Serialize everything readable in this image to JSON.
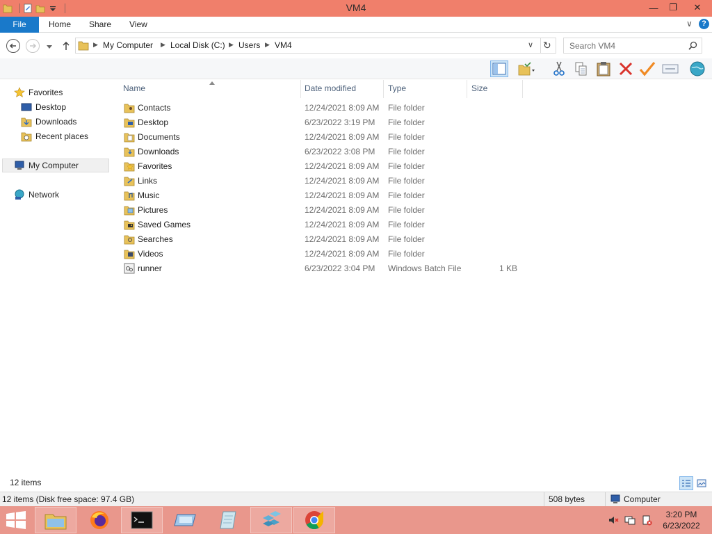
{
  "window": {
    "title": "VM4",
    "minimize_glyph": "—",
    "restore_glyph": "❐",
    "close_glyph": "✕"
  },
  "ribbon": {
    "tabs": [
      {
        "label": "File"
      },
      {
        "label": "Home"
      },
      {
        "label": "Share"
      },
      {
        "label": "View"
      }
    ],
    "expand_glyph": "∨",
    "help_glyph": "?"
  },
  "address": {
    "crumbs": [
      "My Computer",
      "Local Disk (C:)",
      "Users",
      "VM4"
    ],
    "separator": "▶",
    "dropdown_glyph": "∨",
    "refresh_glyph": "↻"
  },
  "search": {
    "placeholder": "Search VM4"
  },
  "navpane": {
    "favorites": "Favorites",
    "favorites_items": [
      "Desktop",
      "Downloads",
      "Recent places"
    ],
    "computer": "My Computer",
    "network": "Network"
  },
  "columns": {
    "name": "Name",
    "date": "Date modified",
    "type": "Type",
    "size": "Size"
  },
  "files": [
    {
      "name": "Contacts",
      "date": "12/24/2021 8:09 AM",
      "type": "File folder",
      "size": "",
      "icon": "contacts-folder-icon"
    },
    {
      "name": "Desktop",
      "date": "6/23/2022 3:19 PM",
      "type": "File folder",
      "size": "",
      "icon": "desktop-folder-icon"
    },
    {
      "name": "Documents",
      "date": "12/24/2021 8:09 AM",
      "type": "File folder",
      "size": "",
      "icon": "documents-folder-icon"
    },
    {
      "name": "Downloads",
      "date": "6/23/2022 3:08 PM",
      "type": "File folder",
      "size": "",
      "icon": "downloads-folder-icon"
    },
    {
      "name": "Favorites",
      "date": "12/24/2021 8:09 AM",
      "type": "File folder",
      "size": "",
      "icon": "favorites-folder-icon"
    },
    {
      "name": "Links",
      "date": "12/24/2021 8:09 AM",
      "type": "File folder",
      "size": "",
      "icon": "links-folder-icon"
    },
    {
      "name": "Music",
      "date": "12/24/2021 8:09 AM",
      "type": "File folder",
      "size": "",
      "icon": "music-folder-icon"
    },
    {
      "name": "Pictures",
      "date": "12/24/2021 8:09 AM",
      "type": "File folder",
      "size": "",
      "icon": "pictures-folder-icon"
    },
    {
      "name": "Saved Games",
      "date": "12/24/2021 8:09 AM",
      "type": "File folder",
      "size": "",
      "icon": "saved-games-folder-icon"
    },
    {
      "name": "Searches",
      "date": "12/24/2021 8:09 AM",
      "type": "File folder",
      "size": "",
      "icon": "searches-folder-icon"
    },
    {
      "name": "Videos",
      "date": "12/24/2021 8:09 AM",
      "type": "File folder",
      "size": "",
      "icon": "videos-folder-icon"
    },
    {
      "name": "runner",
      "date": "6/23/2022 3:04 PM",
      "type": "Windows Batch File",
      "size": "1 KB",
      "icon": "batch-file-icon"
    }
  ],
  "status": {
    "item_count": "12 items",
    "details": "12 items (Disk free space: 97.4 GB)",
    "size": "508 bytes",
    "location": "Computer"
  },
  "clock": {
    "time": "3:20 PM",
    "date": "6/23/2022"
  },
  "colors": {
    "titlebar": "#f07f6b",
    "taskbar": "#e9978c",
    "file_tab": "#1979ca",
    "folder": "#e8c25a"
  }
}
